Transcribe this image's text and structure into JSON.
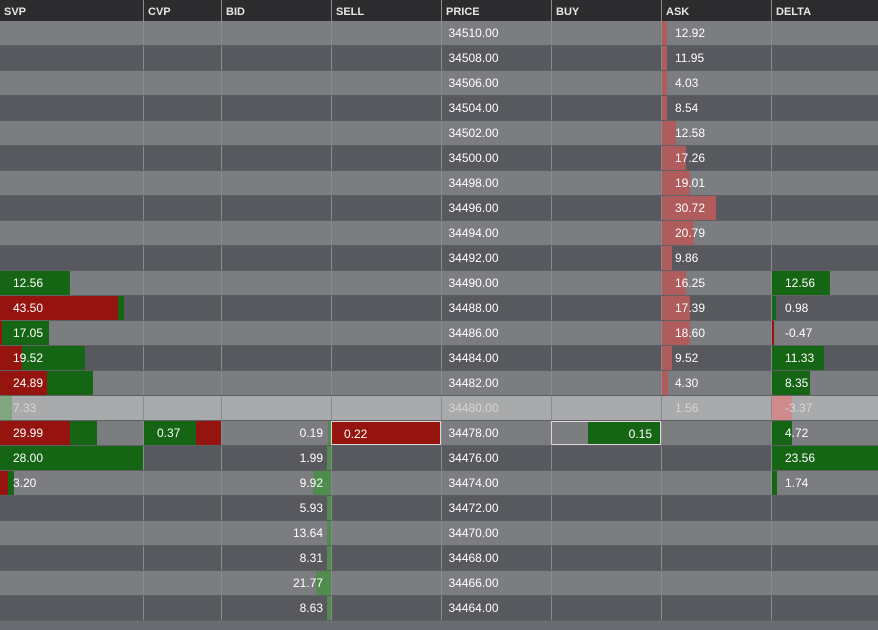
{
  "colors": {
    "svp_buy": "#156514",
    "svp_sell": "#961410",
    "ask_bar": "#b05c5c",
    "bid_bar": "#4f8c4e",
    "delta_positive": "#156514",
    "delta_negative": "#961410",
    "current_row": "#a9aaac"
  },
  "columns": [
    {
      "key": "svp",
      "label": "SVP"
    },
    {
      "key": "cvp",
      "label": "CVP"
    },
    {
      "key": "bid",
      "label": "BID"
    },
    {
      "key": "sell",
      "label": "SELL"
    },
    {
      "key": "price",
      "label": "PRICE"
    },
    {
      "key": "buy",
      "label": "BUY"
    },
    {
      "key": "ask",
      "label": "ASK"
    },
    {
      "key": "delta",
      "label": "DELTA"
    }
  ],
  "ladder": {
    "current_price": "34480.00",
    "rows": [
      {
        "price": "34510.00",
        "svp": "",
        "cvp": "",
        "bid": "",
        "sell": "",
        "buy": "",
        "ask": "12.92",
        "delta": ""
      },
      {
        "price": "34508.00",
        "svp": "",
        "cvp": "",
        "bid": "",
        "sell": "",
        "buy": "",
        "ask": "11.95",
        "delta": ""
      },
      {
        "price": "34506.00",
        "svp": "",
        "cvp": "",
        "bid": "",
        "sell": "",
        "buy": "",
        "ask": "4.03",
        "delta": ""
      },
      {
        "price": "34504.00",
        "svp": "",
        "cvp": "",
        "bid": "",
        "sell": "",
        "buy": "",
        "ask": "8.54",
        "delta": ""
      },
      {
        "price": "34502.00",
        "svp": "",
        "cvp": "",
        "bid": "",
        "sell": "",
        "buy": "",
        "ask": "12.58",
        "delta": ""
      },
      {
        "price": "34500.00",
        "svp": "",
        "cvp": "",
        "bid": "",
        "sell": "",
        "buy": "",
        "ask": "17.26",
        "delta": ""
      },
      {
        "price": "34498.00",
        "svp": "",
        "cvp": "",
        "bid": "",
        "sell": "",
        "buy": "",
        "ask": "19.01",
        "delta": ""
      },
      {
        "price": "34496.00",
        "svp": "",
        "cvp": "",
        "bid": "",
        "sell": "",
        "buy": "",
        "ask": "30.72",
        "delta": ""
      },
      {
        "price": "34494.00",
        "svp": "",
        "cvp": "",
        "bid": "",
        "sell": "",
        "buy": "",
        "ask": "20.79",
        "delta": ""
      },
      {
        "price": "34492.00",
        "svp": "",
        "cvp": "",
        "bid": "",
        "sell": "",
        "buy": "",
        "ask": "9.86",
        "delta": ""
      },
      {
        "price": "34490.00",
        "svp": "12.56",
        "cvp": "",
        "bid": "",
        "sell": "",
        "buy": "",
        "ask": "16.25",
        "delta": "12.56"
      },
      {
        "price": "34488.00",
        "svp": "43.50",
        "cvp": "",
        "bid": "",
        "sell": "",
        "buy": "",
        "ask": "17.39",
        "delta": "0.98"
      },
      {
        "price": "34486.00",
        "svp": "17.05",
        "cvp": "",
        "bid": "",
        "sell": "",
        "buy": "",
        "ask": "18.60",
        "delta": "-0.47"
      },
      {
        "price": "34484.00",
        "svp": "19.52",
        "cvp": "",
        "bid": "",
        "sell": "",
        "buy": "",
        "ask": "9.52",
        "delta": "11.33"
      },
      {
        "price": "34482.00",
        "svp": "24.89",
        "cvp": "",
        "bid": "",
        "sell": "",
        "buy": "",
        "ask": "4.30",
        "delta": "8.35"
      },
      {
        "price": "34480.00",
        "svp": "7.33",
        "cvp": "",
        "bid": "",
        "sell": "",
        "buy": "",
        "ask": "1.56",
        "delta": "-3.37"
      },
      {
        "price": "34478.00",
        "svp": "29.99",
        "cvp": "0.37",
        "bid": "0.19",
        "sell": "0.22",
        "buy": "0.15",
        "ask": "",
        "delta": "4.72"
      },
      {
        "price": "34476.00",
        "svp": "28.00",
        "cvp": "",
        "bid": "1.99",
        "sell": "",
        "buy": "",
        "ask": "",
        "delta": "23.56"
      },
      {
        "price": "34474.00",
        "svp": "3.20",
        "cvp": "",
        "bid": "9.92",
        "sell": "",
        "buy": "",
        "ask": "",
        "delta": "1.74"
      },
      {
        "price": "34472.00",
        "svp": "",
        "cvp": "",
        "bid": "5.93",
        "sell": "",
        "buy": "",
        "ask": "",
        "delta": ""
      },
      {
        "price": "34470.00",
        "svp": "",
        "cvp": "",
        "bid": "13.64",
        "sell": "",
        "buy": "",
        "ask": "",
        "delta": ""
      },
      {
        "price": "34468.00",
        "svp": "",
        "cvp": "",
        "bid": "8.31",
        "sell": "",
        "buy": "",
        "ask": "",
        "delta": ""
      },
      {
        "price": "34466.00",
        "svp": "",
        "cvp": "",
        "bid": "21.77",
        "sell": "",
        "buy": "",
        "ask": "",
        "delta": ""
      },
      {
        "price": "34464.00",
        "svp": "",
        "cvp": "",
        "bid": "8.63",
        "sell": "",
        "buy": "",
        "ask": "",
        "delta": ""
      }
    ]
  }
}
